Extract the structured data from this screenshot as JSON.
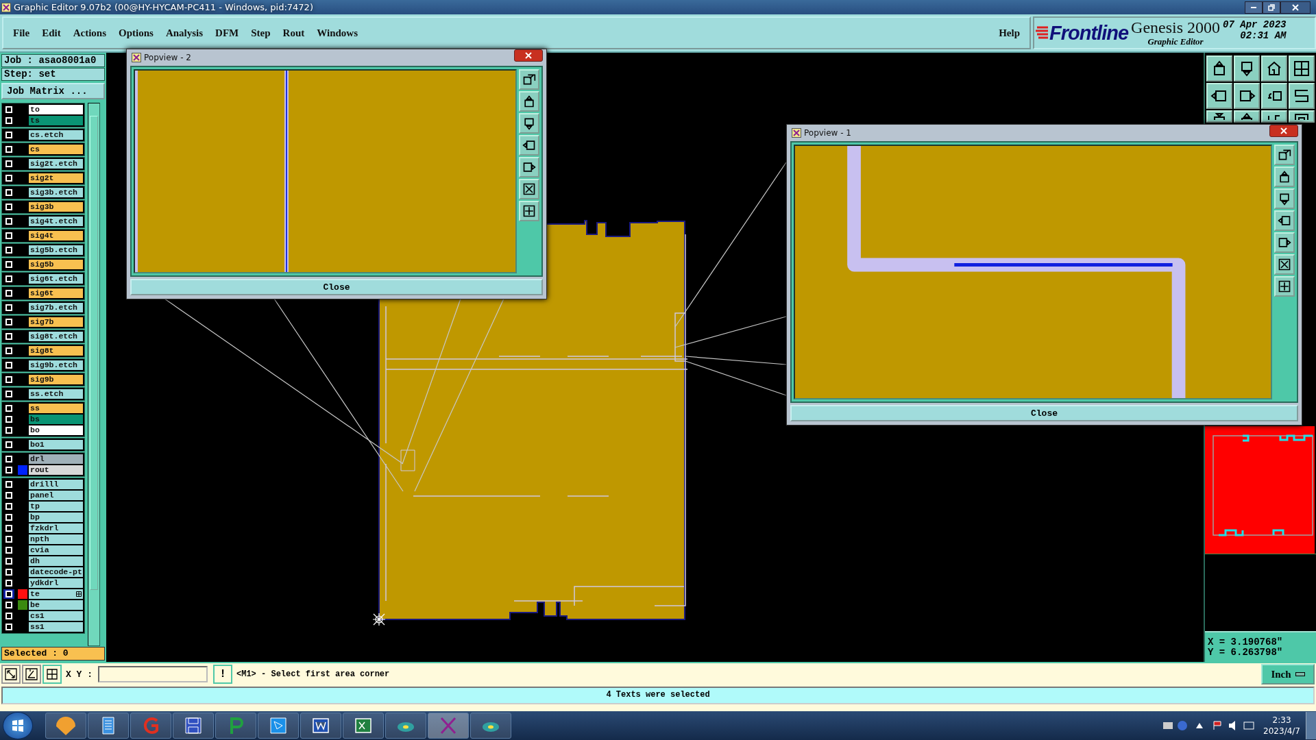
{
  "title_bar": {
    "title": "Graphic Editor 9.07b2 (00@HY-HYCAM-PC411 - Windows, pid:7472)"
  },
  "menu": {
    "items": [
      "File",
      "Edit",
      "Actions",
      "Options",
      "Analysis",
      "DFM",
      "Step",
      "Rout",
      "Windows"
    ],
    "help": "Help"
  },
  "brand": {
    "logo": "Frontline",
    "product": "Genesis 2000",
    "subtitle": "Graphic Editor",
    "date": "07 Apr 2023",
    "time": "02:31 AM"
  },
  "job_panel": {
    "job": "Job : asao8001a0",
    "step": "Step: set",
    "matrix_button": "Job Matrix ...",
    "selected_count": "Selected : 0",
    "layer_groups": [
      [
        {
          "name": "to",
          "color": "#ffffff",
          "checked": false,
          "active": false
        },
        {
          "name": "ts",
          "color": "#0a9474",
          "checked": false,
          "active": false
        }
      ],
      [
        {
          "name": "cs.etch",
          "color": "#9edcdc",
          "checked": false,
          "active": false
        }
      ],
      [
        {
          "name": "cs",
          "color": "#f8c050",
          "checked": false,
          "active": false
        }
      ],
      [
        {
          "name": "sig2t.etch",
          "color": "#9edcdc",
          "checked": false,
          "active": false
        }
      ],
      [
        {
          "name": "sig2t",
          "color": "#f8c050",
          "checked": false,
          "active": false
        }
      ],
      [
        {
          "name": "sig3b.etch",
          "color": "#9edcdc",
          "checked": false,
          "active": false
        }
      ],
      [
        {
          "name": "sig3b",
          "color": "#f8c050",
          "checked": false,
          "active": false
        }
      ],
      [
        {
          "name": "sig4t.etch",
          "color": "#9edcdc",
          "checked": false,
          "active": false
        }
      ],
      [
        {
          "name": "sig4t",
          "color": "#f8c050",
          "checked": false,
          "active": false
        }
      ],
      [
        {
          "name": "sig5b.etch",
          "color": "#9edcdc",
          "checked": false,
          "active": false
        }
      ],
      [
        {
          "name": "sig5b",
          "color": "#f8c050",
          "checked": false,
          "active": false
        }
      ],
      [
        {
          "name": "sig6t.etch",
          "color": "#9edcdc",
          "checked": false,
          "active": false
        }
      ],
      [
        {
          "name": "sig6t",
          "color": "#f8c050",
          "checked": false,
          "active": false
        }
      ],
      [
        {
          "name": "sig7b.etch",
          "color": "#9edcdc",
          "checked": false,
          "active": false
        }
      ],
      [
        {
          "name": "sig7b",
          "color": "#f8c050",
          "checked": false,
          "active": false
        }
      ],
      [
        {
          "name": "sig8t.etch",
          "color": "#9edcdc",
          "checked": false,
          "active": false
        }
      ],
      [
        {
          "name": "sig8t",
          "color": "#f8c050",
          "checked": false,
          "active": false
        }
      ],
      [
        {
          "name": "sig9b.etch",
          "color": "#9edcdc",
          "checked": false,
          "active": false
        }
      ],
      [
        {
          "name": "sig9b",
          "color": "#f8c050",
          "checked": false,
          "active": false
        }
      ],
      [
        {
          "name": "ss.etch",
          "color": "#9edcdc",
          "checked": false,
          "active": false
        }
      ],
      [
        {
          "name": "ss",
          "color": "#f8c050",
          "checked": false,
          "active": false
        },
        {
          "name": "bs",
          "color": "#0a9474",
          "checked": false,
          "active": false
        },
        {
          "name": "bo",
          "color": "#ffffff",
          "checked": false,
          "active": false
        }
      ],
      [
        {
          "name": "bo1",
          "color": "#9edcdc",
          "checked": false,
          "active": false
        }
      ],
      [
        {
          "name": "drl",
          "color": "#a0b0b8",
          "checked": false,
          "active": false
        },
        {
          "name": "rout",
          "color": "#d8d8d8",
          "swatch": {
            "color": "#0022ff"
          },
          "checked": false,
          "active": false
        }
      ],
      [
        {
          "name": "drilll",
          "color": "#9edcdc",
          "checked": false,
          "active": false
        },
        {
          "name": "panel",
          "color": "#9edcdc",
          "checked": false,
          "active": false
        },
        {
          "name": "tp",
          "color": "#9edcdc",
          "checked": false,
          "active": false
        },
        {
          "name": "bp",
          "color": "#9edcdc",
          "checked": false,
          "active": false
        },
        {
          "name": "fzkdrl",
          "color": "#9edcdc",
          "checked": false,
          "active": false
        },
        {
          "name": "npth",
          "color": "#9edcdc",
          "checked": false,
          "active": false
        },
        {
          "name": "cvia",
          "color": "#9edcdc",
          "checked": false,
          "active": false
        },
        {
          "name": "dh",
          "color": "#9edcdc",
          "checked": false,
          "active": false
        },
        {
          "name": "datecode-pt",
          "color": "#9edcdc",
          "checked": false,
          "active": false
        },
        {
          "name": "ydkdrl",
          "color": "#9edcdc",
          "checked": false,
          "active": false
        },
        {
          "name": "te",
          "color": "#9edcdc",
          "swatch": {
            "color": "#ff1010"
          },
          "checked": false,
          "active": true
        },
        {
          "name": "be",
          "color": "#9edcdc",
          "swatch": {
            "color": "#3a8a10"
          },
          "checked": false,
          "active": false
        },
        {
          "name": "cs1",
          "color": "#9edcdc",
          "checked": false,
          "active": false
        },
        {
          "name": "ss1",
          "color": "#9edcdc",
          "checked": false,
          "active": false
        }
      ]
    ]
  },
  "popviews": [
    {
      "title": "Popview - 2",
      "kind": "vertical",
      "close": "Close"
    },
    {
      "title": "Popview - 1",
      "kind": "corner",
      "close": "Close"
    }
  ],
  "coordinates": {
    "x": "X = 3.190768\"",
    "y": "Y = 6.263798\""
  },
  "command_line": {
    "xy_label": "X Y :",
    "alert_button": "!",
    "prompt": "<M1> - Select first area corner",
    "units": "Inch"
  },
  "status_bar": {
    "message": "4 Texts were selected"
  },
  "taskbar": {
    "time": "2:33",
    "date": "2023/4/7"
  }
}
